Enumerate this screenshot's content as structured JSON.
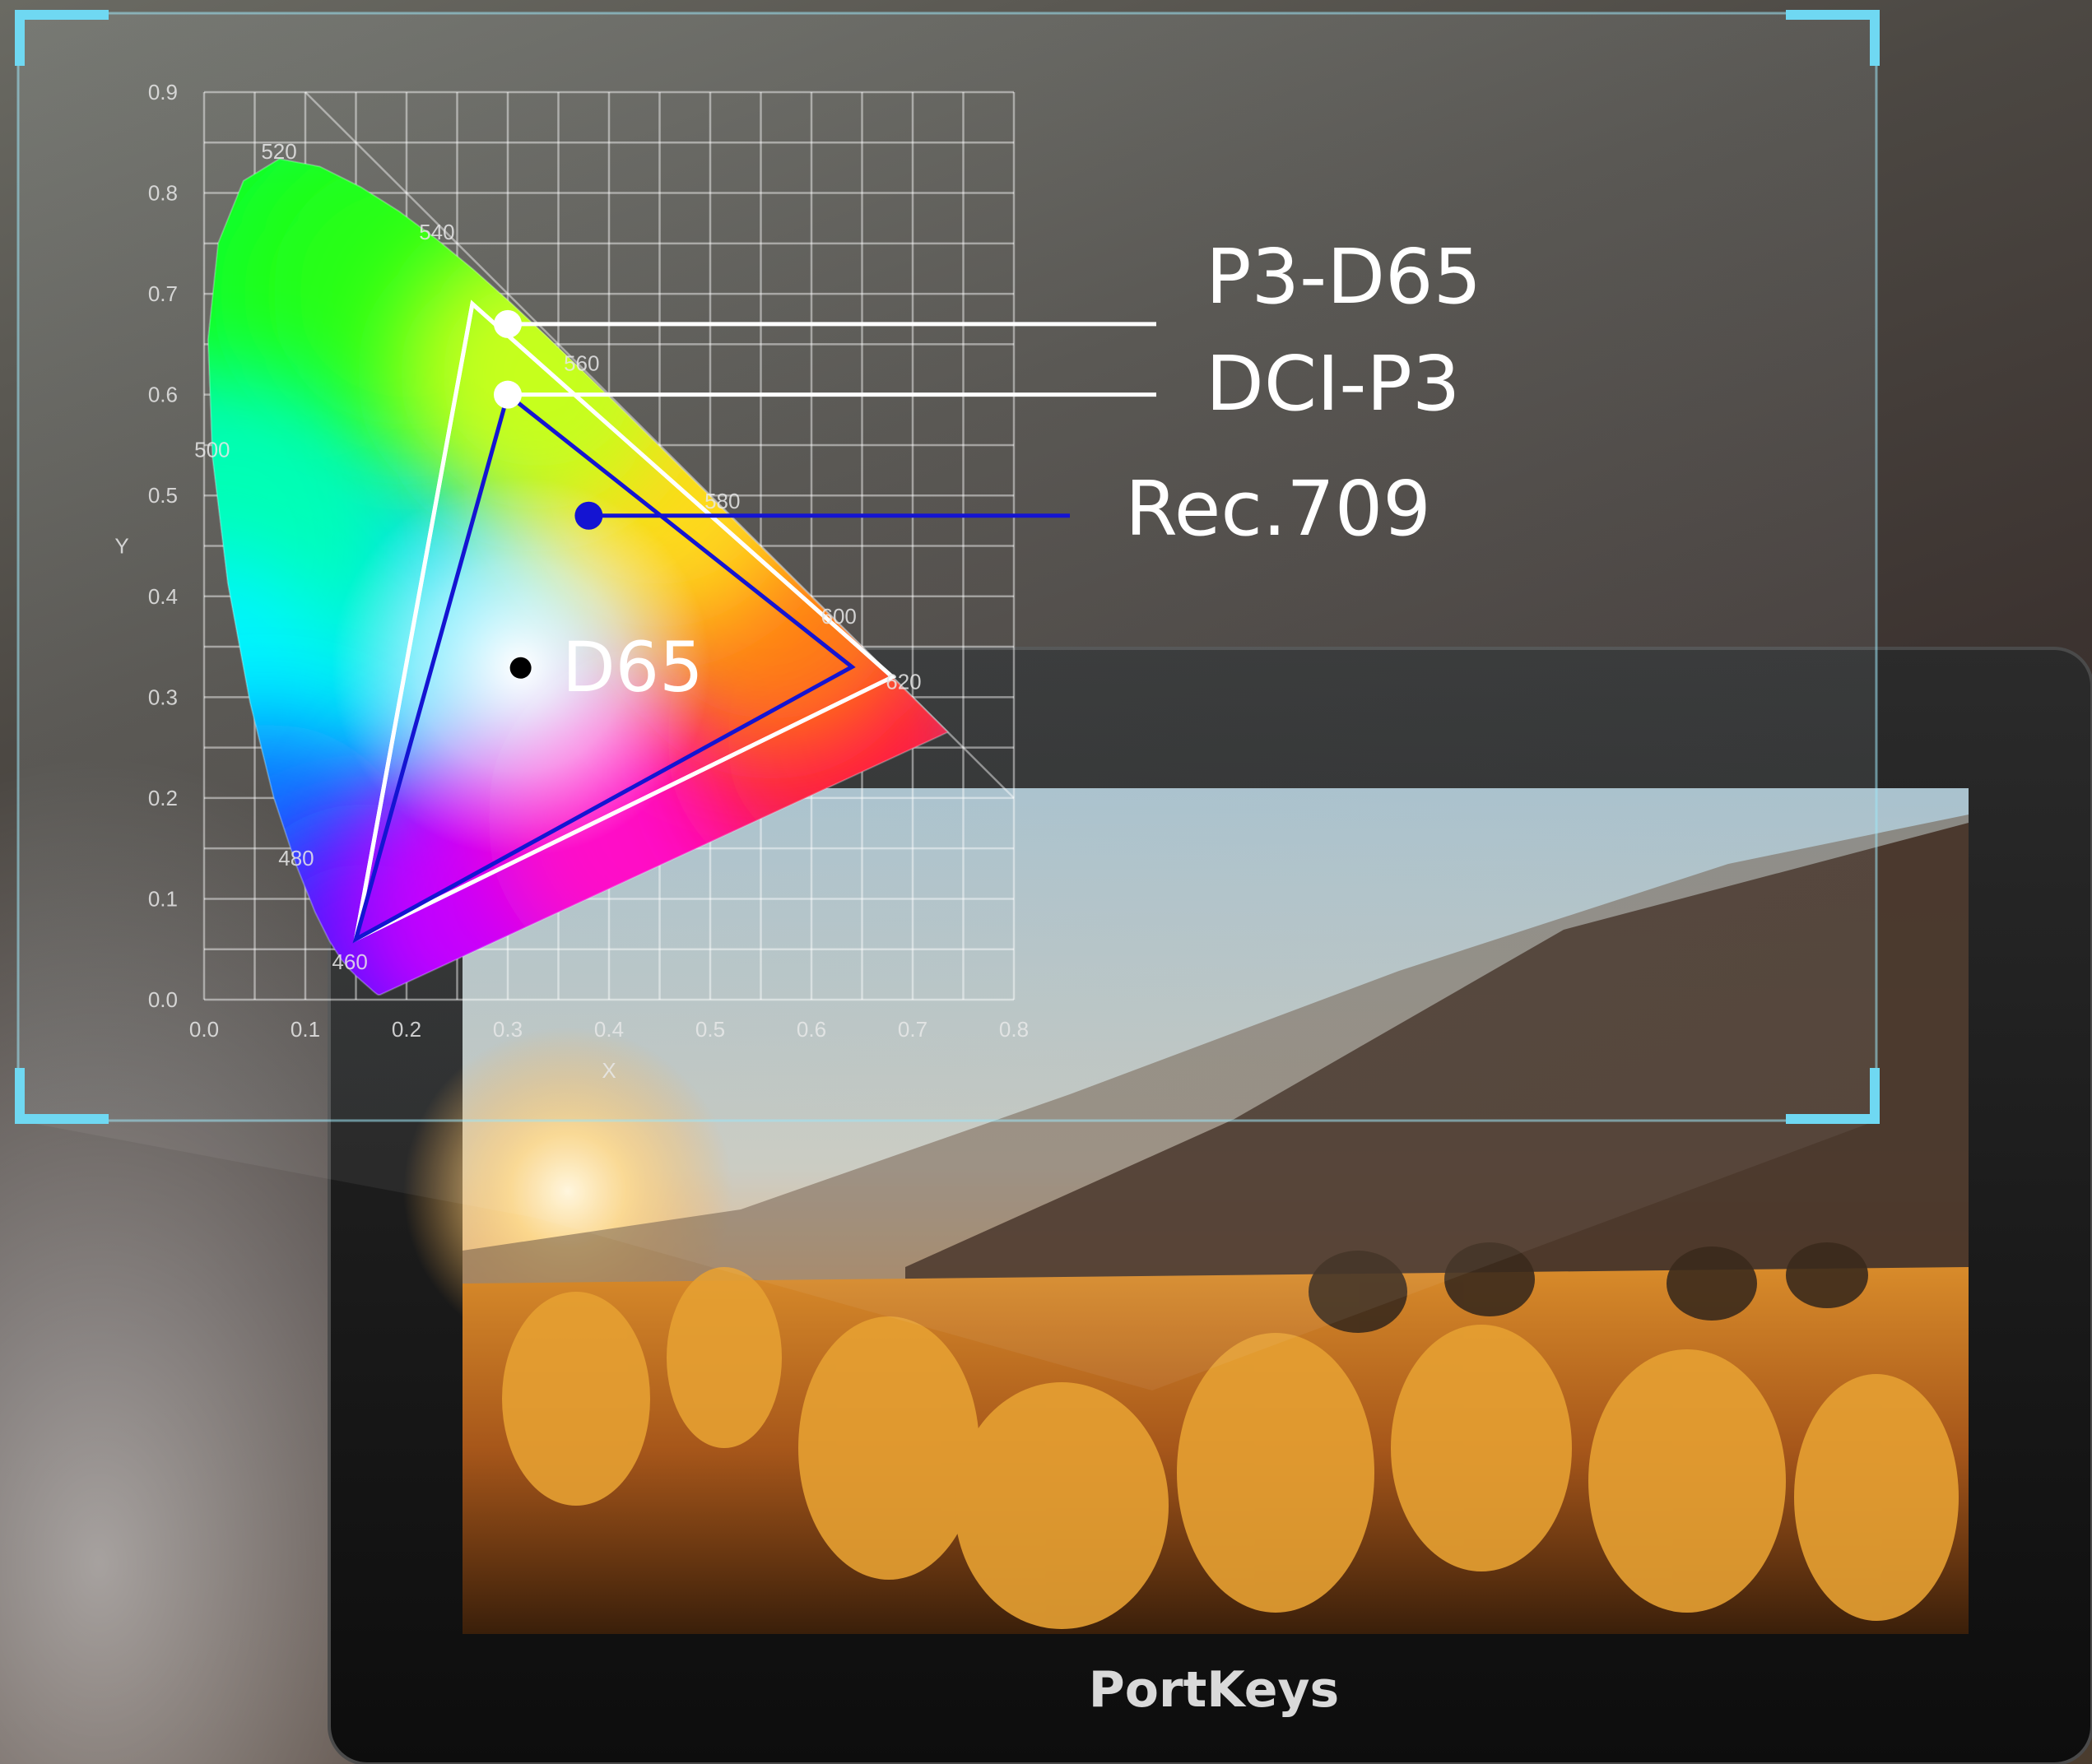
{
  "device": {
    "brand": "PortKeys"
  },
  "colors": {
    "bracket": "#6fd8f2",
    "rec709_line": "#1414d2",
    "p3_d65_line": "#ffffff",
    "dci_p3_line": "#ffffff",
    "d65_point": "#000000"
  },
  "chart_data": {
    "type": "scatter",
    "title": "",
    "xlabel": "X",
    "ylabel": "Y",
    "xlim": [
      0.0,
      0.8
    ],
    "ylim": [
      0.0,
      0.9
    ],
    "x_ticks": [
      "0.0",
      "0.1",
      "0.2",
      "0.3",
      "0.4",
      "0.5",
      "0.6",
      "0.7",
      "0.8"
    ],
    "y_ticks": [
      "0.0",
      "0.1",
      "0.2",
      "0.3",
      "0.4",
      "0.5",
      "0.6",
      "0.7",
      "0.8",
      "0.9"
    ],
    "grid": true,
    "wavelength_labels": [
      {
        "text": "460",
        "x": 0.144,
        "y": 0.03
      },
      {
        "text": "480",
        "x": 0.091,
        "y": 0.133
      },
      {
        "text": "500",
        "x": 0.008,
        "y": 0.538
      },
      {
        "text": "520",
        "x": 0.074,
        "y": 0.834
      },
      {
        "text": "540",
        "x": 0.23,
        "y": 0.754
      },
      {
        "text": "560",
        "x": 0.373,
        "y": 0.624
      },
      {
        "text": "580",
        "x": 0.512,
        "y": 0.487
      },
      {
        "text": "600",
        "x": 0.627,
        "y": 0.373
      },
      {
        "text": "620",
        "x": 0.691,
        "y": 0.308
      }
    ],
    "series": [
      {
        "name": "P3-D65",
        "vertices": [
          [
            0.68,
            0.32
          ],
          [
            0.265,
            0.69
          ],
          [
            0.15,
            0.06
          ]
        ],
        "callout_point": [
          0.3,
          0.67
        ]
      },
      {
        "name": "DCI-P3",
        "vertices": [
          [
            0.68,
            0.32
          ],
          [
            0.265,
            0.69
          ],
          [
            0.15,
            0.06
          ]
        ],
        "callout_point": [
          0.3,
          0.6
        ]
      },
      {
        "name": "Rec.709",
        "vertices": [
          [
            0.64,
            0.33
          ],
          [
            0.3,
            0.6
          ],
          [
            0.15,
            0.06
          ]
        ],
        "callout_point": [
          0.38,
          0.48
        ]
      },
      {
        "name": "D65",
        "vertices": [
          [
            0.3127,
            0.329
          ]
        ],
        "callout_point": [
          0.3127,
          0.329
        ]
      }
    ],
    "spectral_locus": [
      [
        0.1741,
        0.005
      ],
      [
        0.1738,
        0.0049
      ],
      [
        0.1736,
        0.0049
      ],
      [
        0.1733,
        0.0048
      ],
      [
        0.173,
        0.0048
      ],
      [
        0.1726,
        0.0048
      ],
      [
        0.1721,
        0.0048
      ],
      [
        0.1714,
        0.0051
      ],
      [
        0.1703,
        0.0058
      ],
      [
        0.1689,
        0.0069
      ],
      [
        0.1669,
        0.0086
      ],
      [
        0.1644,
        0.0109
      ],
      [
        0.1611,
        0.0138
      ],
      [
        0.1566,
        0.0177
      ],
      [
        0.151,
        0.0227
      ],
      [
        0.144,
        0.0297
      ],
      [
        0.1355,
        0.0399
      ],
      [
        0.1241,
        0.0578
      ],
      [
        0.1096,
        0.0868
      ],
      [
        0.0913,
        0.1327
      ],
      [
        0.0687,
        0.2007
      ],
      [
        0.0454,
        0.295
      ],
      [
        0.0235,
        0.4127
      ],
      [
        0.0082,
        0.5384
      ],
      [
        0.0039,
        0.6548
      ],
      [
        0.0139,
        0.7502
      ],
      [
        0.0389,
        0.812
      ],
      [
        0.0743,
        0.8338
      ],
      [
        0.1142,
        0.8262
      ],
      [
        0.1547,
        0.8059
      ],
      [
        0.1929,
        0.7816
      ],
      [
        0.2296,
        0.7543
      ],
      [
        0.2658,
        0.7243
      ],
      [
        0.3016,
        0.6923
      ],
      [
        0.3373,
        0.6589
      ],
      [
        0.3731,
        0.6245
      ],
      [
        0.4087,
        0.5896
      ],
      [
        0.4441,
        0.5547
      ],
      [
        0.4788,
        0.5202
      ],
      [
        0.5125,
        0.4866
      ],
      [
        0.5448,
        0.4544
      ],
      [
        0.5752,
        0.4242
      ],
      [
        0.6029,
        0.3965
      ],
      [
        0.627,
        0.3725
      ],
      [
        0.6482,
        0.3514
      ],
      [
        0.6658,
        0.334
      ],
      [
        0.6801,
        0.3197
      ],
      [
        0.6915,
        0.3083
      ],
      [
        0.7006,
        0.2993
      ],
      [
        0.7079,
        0.292
      ],
      [
        0.714,
        0.2859
      ],
      [
        0.719,
        0.2809
      ],
      [
        0.723,
        0.277
      ],
      [
        0.726,
        0.274
      ],
      [
        0.7283,
        0.2717
      ],
      [
        0.73,
        0.27
      ],
      [
        0.7311,
        0.2689
      ],
      [
        0.732,
        0.268
      ],
      [
        0.7327,
        0.2673
      ],
      [
        0.7334,
        0.2666
      ],
      [
        0.734,
        0.266
      ],
      [
        0.7344,
        0.2656
      ],
      [
        0.7346,
        0.2654
      ],
      [
        0.7347,
        0.2653
      ]
    ]
  }
}
